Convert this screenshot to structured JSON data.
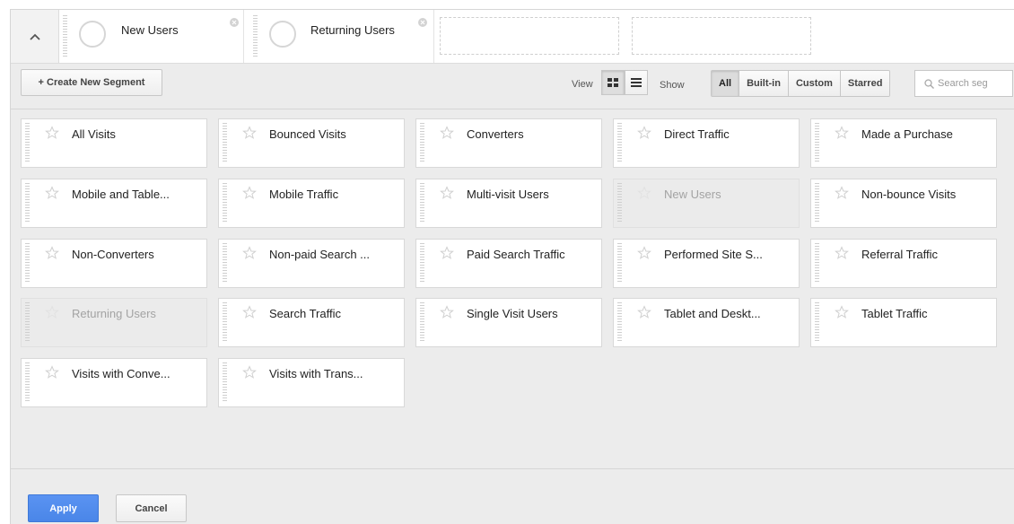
{
  "selected_segments": [
    {
      "name": "New Users"
    },
    {
      "name": "Returning Users"
    }
  ],
  "toolbar": {
    "create_label": "+ Create New Segment",
    "view_label": "View",
    "show_label": "Show",
    "filters": [
      "All",
      "Built-in",
      "Custom",
      "Starred"
    ],
    "active_filter": "All",
    "search_placeholder": "Search seg"
  },
  "segments": [
    {
      "label": "All Visits",
      "disabled": false
    },
    {
      "label": "Bounced Visits",
      "disabled": false
    },
    {
      "label": "Converters",
      "disabled": false
    },
    {
      "label": "Direct Traffic",
      "disabled": false
    },
    {
      "label": "Made a Purchase",
      "disabled": false
    },
    {
      "label": "Mobile and Table...",
      "disabled": false
    },
    {
      "label": "Mobile Traffic",
      "disabled": false
    },
    {
      "label": "Multi-visit Users",
      "disabled": false
    },
    {
      "label": "New Users",
      "disabled": true
    },
    {
      "label": "Non-bounce Visits",
      "disabled": false
    },
    {
      "label": "Non-Converters",
      "disabled": false
    },
    {
      "label": "Non-paid Search ...",
      "disabled": false
    },
    {
      "label": "Paid Search Traffic",
      "disabled": false
    },
    {
      "label": "Performed Site S...",
      "disabled": false
    },
    {
      "label": "Referral Traffic",
      "disabled": false
    },
    {
      "label": "Returning Users",
      "disabled": true
    },
    {
      "label": "Search Traffic",
      "disabled": false
    },
    {
      "label": "Single Visit Users",
      "disabled": false
    },
    {
      "label": "Tablet and Deskt...",
      "disabled": false
    },
    {
      "label": "Tablet Traffic",
      "disabled": false
    },
    {
      "label": "Visits with Conve...",
      "disabled": false
    },
    {
      "label": "Visits with Trans...",
      "disabled": false
    }
  ],
  "footer": {
    "apply_label": "Apply",
    "cancel_label": "Cancel"
  },
  "colors": {
    "apply_blue": "#4a86e8",
    "panel_bg": "#ececec",
    "star": "#d0d0d0"
  }
}
